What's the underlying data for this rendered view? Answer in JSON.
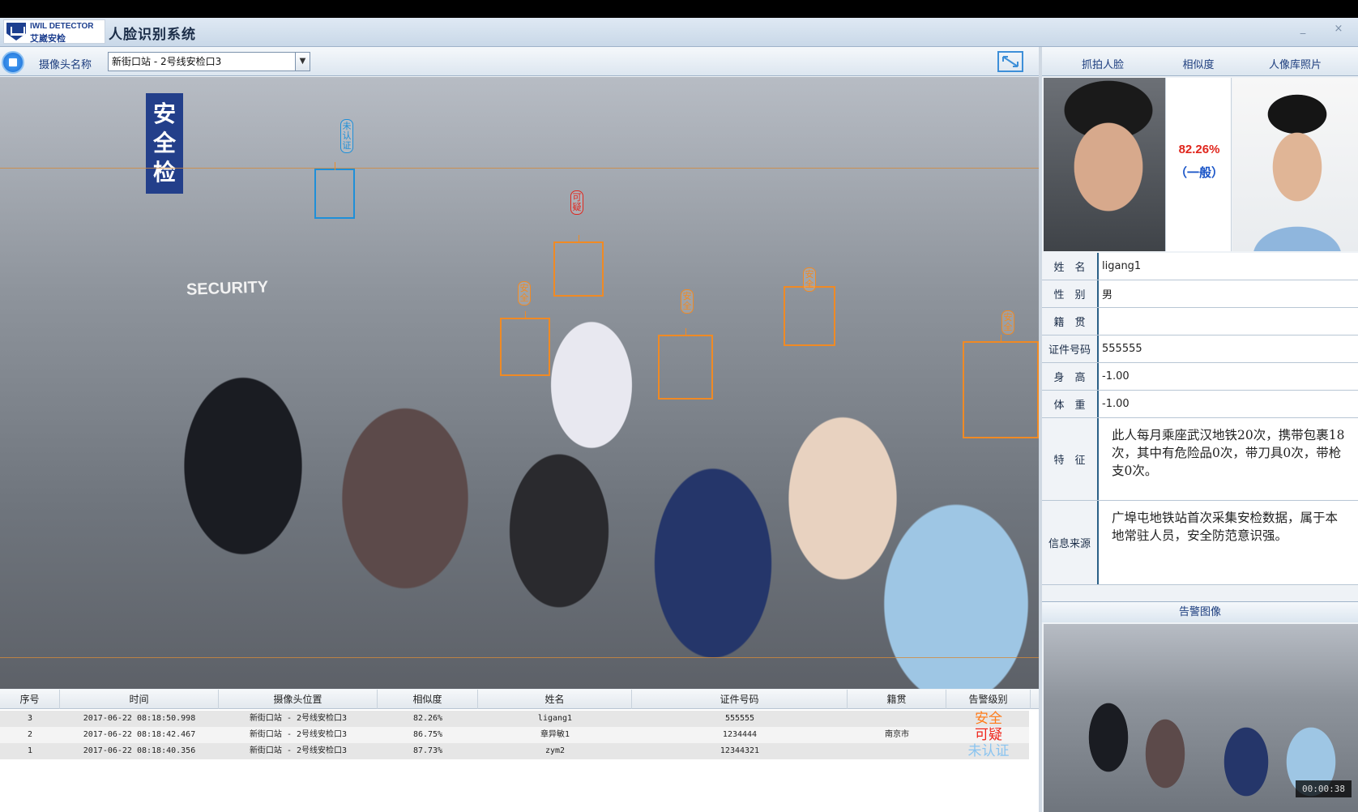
{
  "app": {
    "logo_en": "IWIL DETECTOR",
    "logo_cn": "艾崴安检",
    "title": "人脸识别系统",
    "minimize_label": "_",
    "close_label": "×"
  },
  "toolbar": {
    "camera_label": "摄像头名称",
    "camera_selected": "新街口站 - 2号线安检口3"
  },
  "video": {
    "security_text": "SECURITY",
    "sign_text": "安全检",
    "faces": [
      {
        "tag": "未认证",
        "style": "blue"
      },
      {
        "tag": "可疑",
        "style": "red"
      },
      {
        "tag": "安全",
        "style": "orange"
      },
      {
        "tag": "安全",
        "style": "orange"
      },
      {
        "tag": "安全",
        "style": "orange"
      },
      {
        "tag": "安全",
        "style": "orange"
      }
    ]
  },
  "table": {
    "headers": [
      "序号",
      "时间",
      "摄像头位置",
      "相似度",
      "姓名",
      "证件号码",
      "籍贯",
      "告警级别"
    ],
    "rows": [
      {
        "no": "3",
        "time": "2017-06-22 08:18:50.998",
        "location": "新街口站 - 2号线安检口3",
        "similarity": "82.26%",
        "name": "ligang1",
        "id": "555555",
        "origin": "",
        "level": "安全",
        "level_style": "orange"
      },
      {
        "no": "2",
        "time": "2017-06-22 08:18:42.467",
        "location": "新街口站 - 2号线安检口3",
        "similarity": "86.75%",
        "name": "章异敏1",
        "id": "1234444",
        "origin": "南京市",
        "level": "可疑",
        "level_style": "red"
      },
      {
        "no": "1",
        "time": "2017-06-22 08:18:40.356",
        "location": "新街口站 - 2号线安检口3",
        "similarity": "87.73%",
        "name": "zym2",
        "id": "12344321",
        "origin": "",
        "level": "未认证",
        "level_style": "blue"
      }
    ]
  },
  "right_panel": {
    "headers": [
      "抓拍人脸",
      "相似度",
      "人像库照片"
    ],
    "similarity_value": "82.26%",
    "similarity_level": "（一般）",
    "info": [
      {
        "label": "姓　名",
        "value": "ligang1"
      },
      {
        "label": "性　别",
        "value": "男"
      },
      {
        "label": "籍　贯",
        "value": ""
      },
      {
        "label": "证件号码",
        "value": "555555"
      },
      {
        "label": "身　高",
        "value": "-1.00"
      },
      {
        "label": "体　重",
        "value": "-1.00"
      },
      {
        "label": "特　征",
        "value": "此人每月乘座武汉地铁20次，携带包裹18次，其中有危险品0次，带刀具0次，带枪支0次。"
      },
      {
        "label": "信息来源",
        "value": "广埠屯地铁站首次采集安检数据，属于本地常驻人员，安全防范意识强。"
      }
    ],
    "alert_title": "告警图像",
    "alert_timestamp": "00:00:38"
  },
  "colors": {
    "face_box": "#f08a24",
    "level_safe": "#ff7c1a",
    "level_suspicious": "#f0241a",
    "level_unverified": "#8ac4f0",
    "similarity_text": "#e0251c"
  }
}
